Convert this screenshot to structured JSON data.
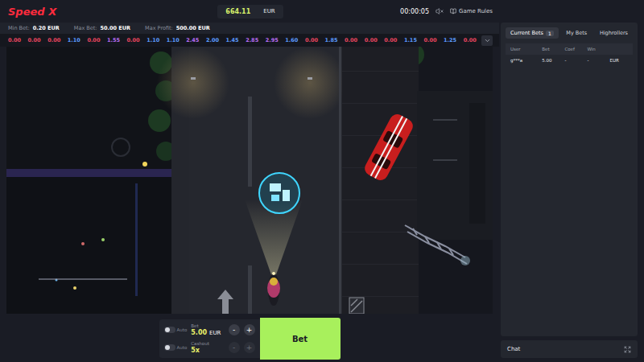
{
  "logo": "Speed X",
  "balance": {
    "amount": "664.11",
    "currency": "EUR"
  },
  "timer": "00:00:05",
  "sound": {
    "muted": true
  },
  "rules": "Game Rules",
  "limits": [
    {
      "label": "Min Bet:",
      "value": "0.20 EUR"
    },
    {
      "label": "Max Bet:",
      "value": "50.00 EUR"
    },
    {
      "label": "Max Profit:",
      "value": "500.00 EUR"
    }
  ],
  "history": [
    {
      "value": "0.00",
      "color": "#e8455e"
    },
    {
      "value": "0.00",
      "color": "#e8455e"
    },
    {
      "value": "0.00",
      "color": "#e8455e"
    },
    {
      "value": "1.10",
      "color": "#5b9bff"
    },
    {
      "value": "0.00",
      "color": "#e8455e"
    },
    {
      "value": "1.55",
      "color": "#b76cf2"
    },
    {
      "value": "0.00",
      "color": "#e8455e"
    },
    {
      "value": "1.10",
      "color": "#5b9bff"
    },
    {
      "value": "1.10",
      "color": "#5b9bff"
    },
    {
      "value": "2.45",
      "color": "#b76cf2"
    },
    {
      "value": "2.00",
      "color": "#5b9bff"
    },
    {
      "value": "1.45",
      "color": "#5b9bff"
    },
    {
      "value": "2.85",
      "color": "#b76cf2"
    },
    {
      "value": "2.95",
      "color": "#b76cf2"
    },
    {
      "value": "1.60",
      "color": "#5b9bff"
    },
    {
      "value": "0.00",
      "color": "#e8455e"
    },
    {
      "value": "1.85",
      "color": "#5b9bff"
    },
    {
      "value": "0.00",
      "color": "#e8455e"
    },
    {
      "value": "0.00",
      "color": "#e8455e"
    },
    {
      "value": "0.00",
      "color": "#e8455e"
    },
    {
      "value": "1.15",
      "color": "#5b9bff"
    },
    {
      "value": "0.00",
      "color": "#e8455e"
    },
    {
      "value": "1.25",
      "color": "#5b9bff"
    },
    {
      "value": "0.00",
      "color": "#e8455e"
    }
  ],
  "bets_panel": {
    "tabs": [
      {
        "label": "Current Bets",
        "count": "1",
        "selected": true
      },
      {
        "label": "My Bets",
        "count": "",
        "selected": false
      },
      {
        "label": "Highrollers",
        "count": "",
        "selected": false
      }
    ],
    "columns": [
      "User",
      "Bet",
      "Coef",
      "Win"
    ],
    "rows": [
      {
        "cells": [
          "g***a",
          "5.00",
          "-",
          "-",
          "EUR"
        ]
      }
    ]
  },
  "controls": {
    "fields": [
      {
        "toggle_label": "Auto",
        "on": false,
        "label": "Bet",
        "value": "5.00",
        "unit": "EUR",
        "minus": "-",
        "plus": "+",
        "disabled": false
      },
      {
        "toggle_label": "Auto",
        "on": false,
        "label": "Cashout",
        "value": "5x",
        "unit": "",
        "minus": "-",
        "plus": "+",
        "disabled": true
      }
    ],
    "button": "Bet"
  },
  "chat": {
    "label": "Chat"
  }
}
